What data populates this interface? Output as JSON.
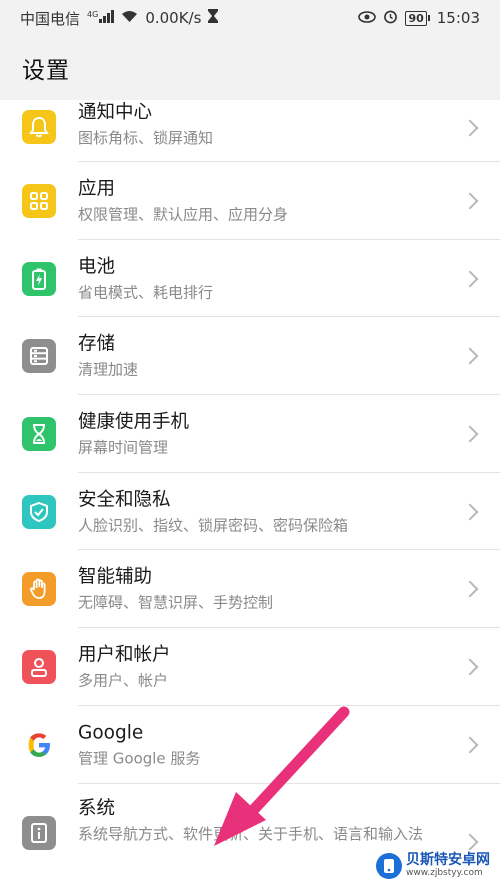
{
  "statusbar": {
    "carrier": "中国电信",
    "signal_tag": "4G",
    "speed": "0.00K/s",
    "battery": "90",
    "time": "15:03"
  },
  "header": {
    "title": "设置"
  },
  "items": [
    {
      "title": "通知中心",
      "subtitle": "图标角标、锁屏通知",
      "icon": "bell-icon",
      "color": "#f5c518"
    },
    {
      "title": "应用",
      "subtitle": "权限管理、默认应用、应用分身",
      "icon": "apps-grid-icon",
      "color": "#f5c518"
    },
    {
      "title": "电池",
      "subtitle": "省电模式、耗电排行",
      "icon": "battery-icon",
      "color": "#2fc36b"
    },
    {
      "title": "存储",
      "subtitle": "清理加速",
      "icon": "storage-icon",
      "color": "#8e8e8e"
    },
    {
      "title": "健康使用手机",
      "subtitle": "屏幕时间管理",
      "icon": "hourglass-icon",
      "color": "#2fc36b"
    },
    {
      "title": "安全和隐私",
      "subtitle": "人脸识别、指纹、锁屏密码、密码保险箱",
      "icon": "shield-icon",
      "color": "#2fc6c0"
    },
    {
      "title": "智能辅助",
      "subtitle": "无障碍、智慧识屏、手势控制",
      "icon": "hand-icon",
      "color": "#f39c2a"
    },
    {
      "title": "用户和帐户",
      "subtitle": "多用户、帐户",
      "icon": "user-icon",
      "color": "#f0525a"
    },
    {
      "title": "Google",
      "subtitle": "管理 Google 服务",
      "icon": "google-icon",
      "color": "#ffffff"
    },
    {
      "title": "系统",
      "subtitle": "系统导航方式、软件更新、关于手机、语言和输入法",
      "icon": "info-icon",
      "color": "#8e8e8e"
    }
  ],
  "watermark": {
    "name": "贝斯特安卓网",
    "url": "www.zjbstyy.com"
  },
  "colors": {
    "arrow": "#e8317a",
    "background": "#f2f2f2"
  }
}
